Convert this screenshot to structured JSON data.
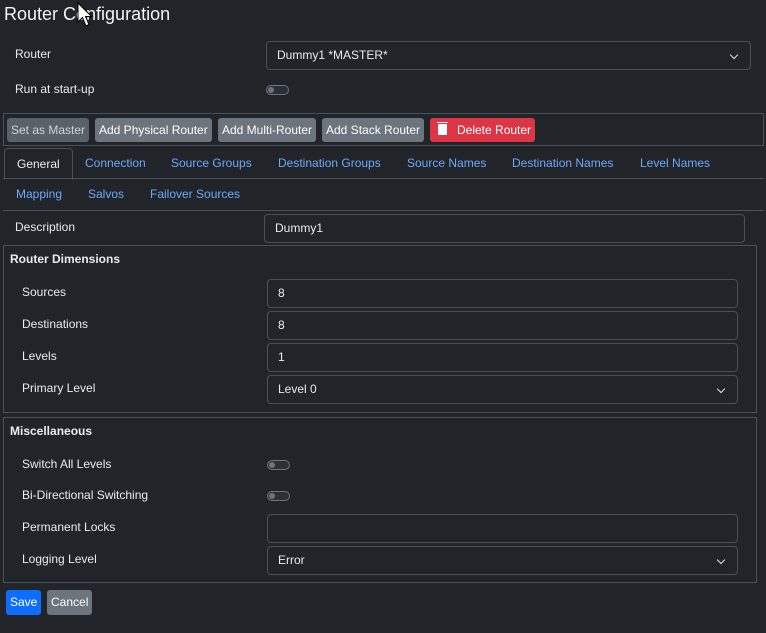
{
  "page": {
    "title": "Router Configuration"
  },
  "header": {
    "router_label": "Router",
    "router_value": "Dummy1 *MASTER*",
    "run_at_startup_label": "Run at start-up"
  },
  "toolbar": {
    "set_as_master": "Set as Master",
    "add_physical_router": "Add Physical Router",
    "add_multi_router": "Add Multi-Router",
    "add_stack_router": "Add Stack Router",
    "delete_router": "Delete Router"
  },
  "tabs": [
    {
      "label": "General"
    },
    {
      "label": "Connection"
    },
    {
      "label": "Source Groups"
    },
    {
      "label": "Destination Groups"
    },
    {
      "label": "Source Names"
    },
    {
      "label": "Destination Names"
    },
    {
      "label": "Level Names"
    },
    {
      "label": "Mapping"
    },
    {
      "label": "Salvos"
    },
    {
      "label": "Failover Sources"
    }
  ],
  "general": {
    "description_label": "Description",
    "description_value": "Dummy1"
  },
  "dimensions": {
    "legend": "Router Dimensions",
    "sources_label": "Sources",
    "sources_value": "8",
    "destinations_label": "Destinations",
    "destinations_value": "8",
    "levels_label": "Levels",
    "levels_value": "1",
    "primary_level_label": "Primary Level",
    "primary_level_value": "Level 0"
  },
  "misc": {
    "legend": "Miscellaneous",
    "switch_all_levels_label": "Switch All Levels",
    "bidirectional_label": "Bi-Directional Switching",
    "permanent_locks_label": "Permanent Locks",
    "permanent_locks_value": "",
    "logging_level_label": "Logging Level",
    "logging_level_value": "Error"
  },
  "footer": {
    "save": "Save",
    "cancel": "Cancel"
  },
  "colors": {
    "accent": "#0d6efd",
    "danger": "#dc3545",
    "link": "#6ea8fe",
    "background": "#212529"
  }
}
